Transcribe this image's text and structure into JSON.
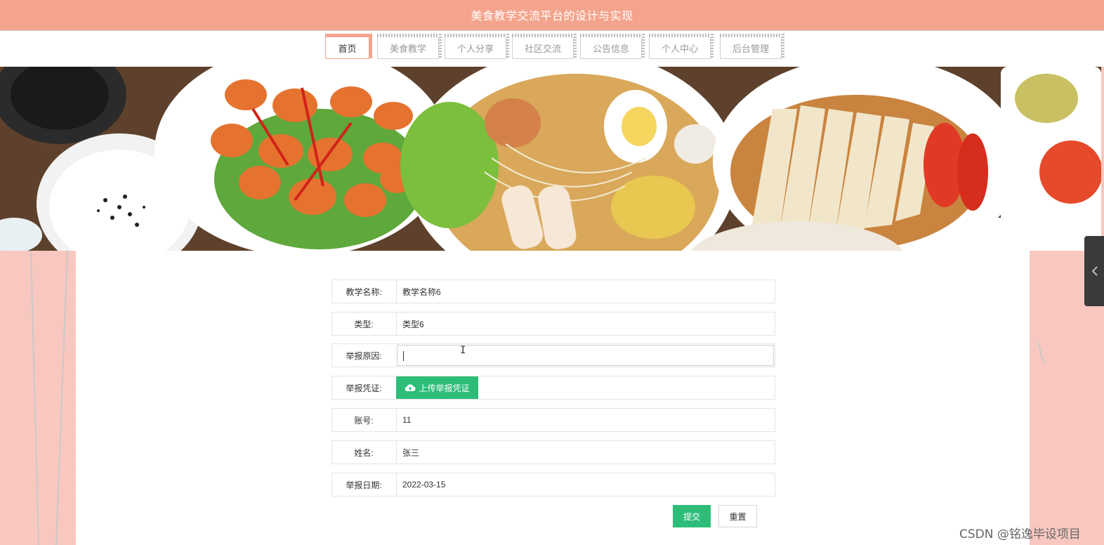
{
  "header": {
    "title": "美食教学交流平台的设计与实现"
  },
  "nav": {
    "items": [
      {
        "label": "首页",
        "active": true
      },
      {
        "label": "美食教学",
        "active": false
      },
      {
        "label": "个人分享",
        "active": false
      },
      {
        "label": "社区交流",
        "active": false
      },
      {
        "label": "公告信息",
        "active": false
      },
      {
        "label": "个人中心",
        "active": false
      },
      {
        "label": "后台管理",
        "active": false
      }
    ]
  },
  "form": {
    "teaching_name": {
      "label": "教学名称:",
      "value": "教学名称6"
    },
    "type": {
      "label": "类型:",
      "value": "类型6"
    },
    "report_reason": {
      "label": "举报原因:",
      "value": ""
    },
    "report_proof": {
      "label": "举报凭证:",
      "button": "上传举报凭证"
    },
    "account": {
      "label": "账号:",
      "value": "11"
    },
    "name": {
      "label": "姓名:",
      "value": "张三"
    },
    "report_date": {
      "label": "举报日期:",
      "value": "2022-03-15"
    },
    "submit_label": "提交",
    "reset_label": "重置"
  },
  "watermark": "CSDN @铭逸毕设项目",
  "colors": {
    "header_bg": "#f4a48c",
    "page_bg": "#f8c8c0",
    "primary_button": "#2ebd78"
  }
}
